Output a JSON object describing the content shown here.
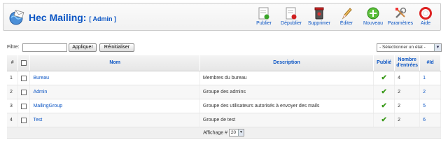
{
  "header": {
    "title": "Hec Mailing:",
    "subtitle": "[ Admin ]"
  },
  "toolbar": [
    {
      "label": "Publier",
      "icon": "publish-icon"
    },
    {
      "label": "Dépublier",
      "icon": "unpublish-icon"
    },
    {
      "label": "Supprimer",
      "icon": "trash-icon"
    },
    {
      "label": "Éditer",
      "icon": "edit-icon"
    },
    {
      "label": "Nouveau",
      "icon": "new-icon"
    },
    {
      "label": "Paramètres",
      "icon": "settings-icon"
    },
    {
      "label": "Aide",
      "icon": "help-icon"
    }
  ],
  "filter": {
    "label": "Filtre:",
    "value": "",
    "apply_label": "Appliquer",
    "reset_label": "Réinitialiser",
    "state_select": "- Sélectionner un état -"
  },
  "table": {
    "headers": {
      "num": "#",
      "nom": "Nom",
      "description": "Description",
      "publie": "Publié",
      "entries": "Nombre d'entrées",
      "id": "#Id"
    },
    "rows": [
      {
        "num": "1",
        "nom": "Bureau",
        "description": "Membres du bureau",
        "entries": "4",
        "id": "1"
      },
      {
        "num": "2",
        "nom": "Admin",
        "description": "Groupe des admins",
        "entries": "2",
        "id": "2"
      },
      {
        "num": "3",
        "nom": "MailingGroup",
        "description": "Groupe des utilisateurs autorisés à envoyer des mails",
        "entries": "2",
        "id": "5"
      },
      {
        "num": "4",
        "nom": "Test",
        "description": "Groupe de test",
        "entries": "2",
        "id": "6"
      }
    ],
    "footer": {
      "display_label": "Affichage #",
      "display_value": "20"
    }
  },
  "colors": {
    "link": "#0B55C4",
    "check": "#3a9a1a"
  }
}
